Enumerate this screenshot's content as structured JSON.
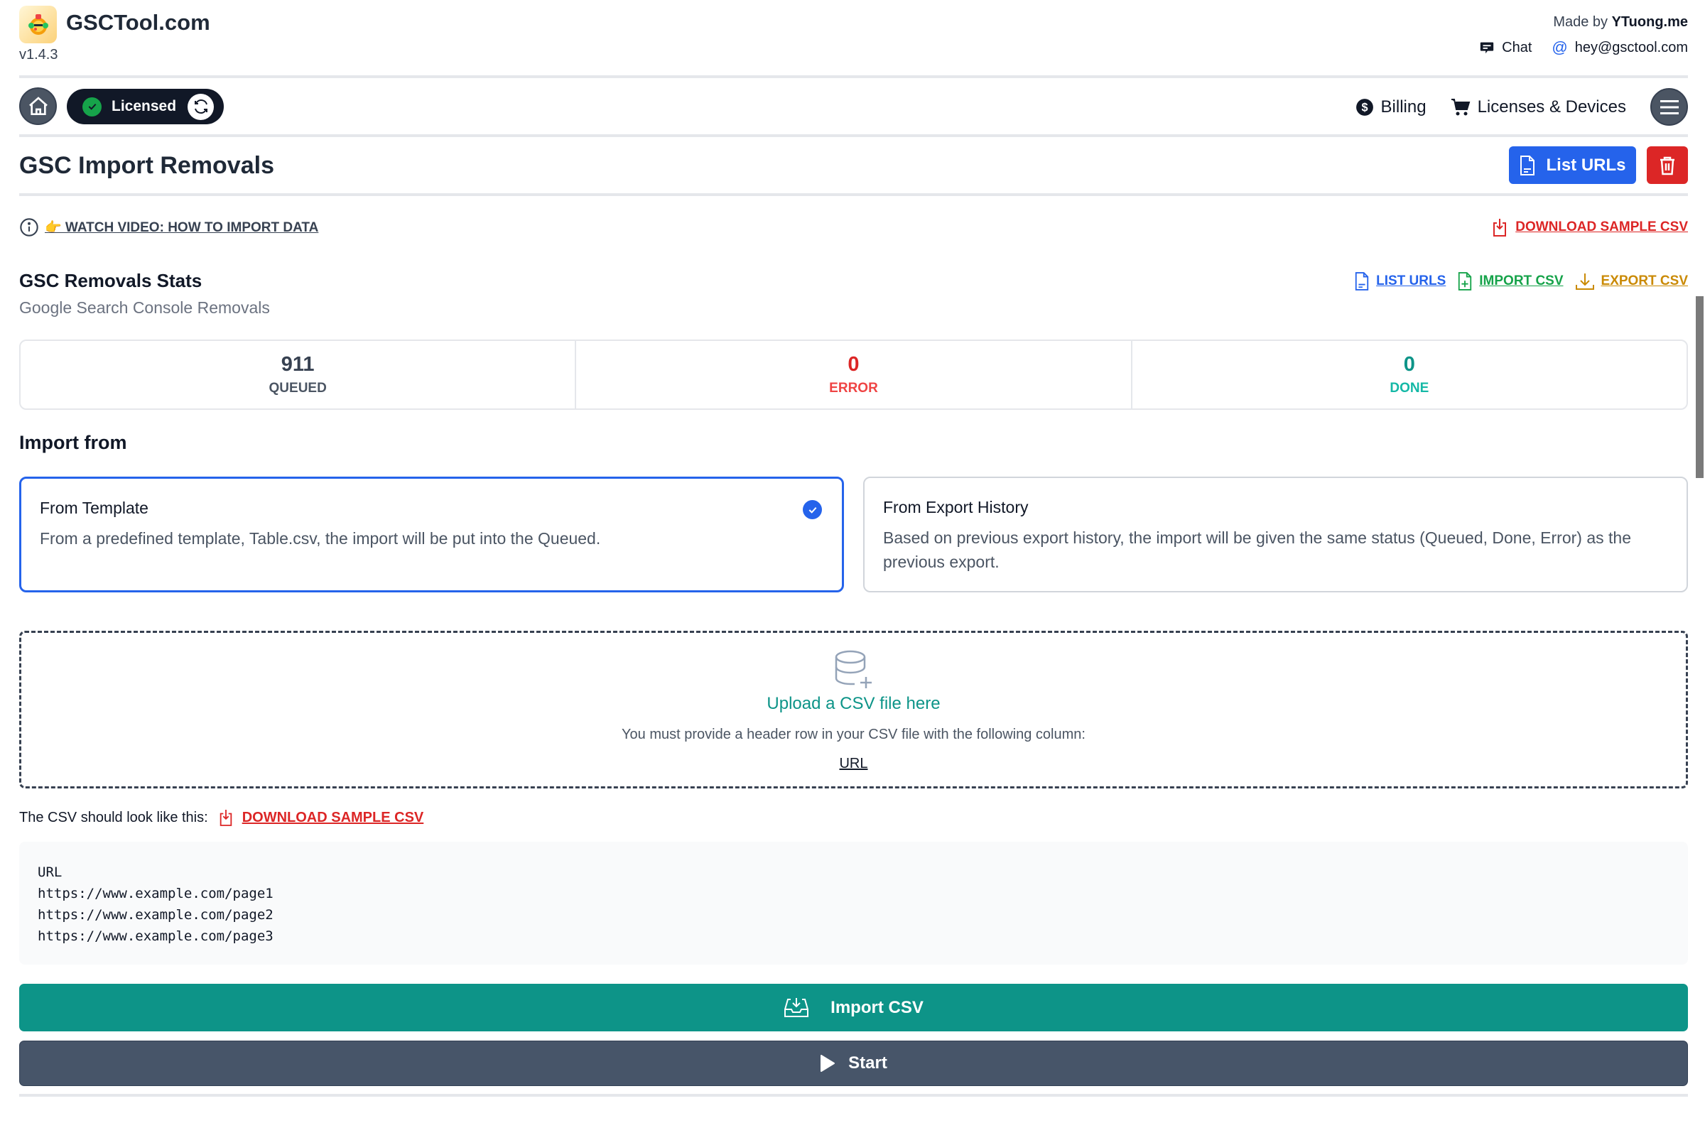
{
  "header": {
    "brand": "GSCTool.com",
    "version": "v1.4.3",
    "made_by_prefix": "Made by",
    "made_by_name": "YTuong.me",
    "chat_label": "Chat",
    "email": "hey@gsctool.com"
  },
  "nav": {
    "license_status": "Licensed",
    "billing_label": "Billing",
    "licenses_label": "Licenses & Devices"
  },
  "page": {
    "title": "GSC Import Removals",
    "list_urls_button": "List URLs",
    "watch_video": "👉 WATCH VIDEO: HOW TO IMPORT DATA",
    "download_sample": "DOWNLOAD SAMPLE CSV"
  },
  "stats": {
    "title": "GSC Removals Stats",
    "subtitle": "Google Search Console Removals",
    "links": {
      "list_urls": "LIST URLS",
      "import_csv": "IMPORT CSV",
      "export_csv": "EXPORT CSV"
    },
    "items": [
      {
        "value": "911",
        "label": "QUEUED",
        "color": "#374151",
        "label_color": "#4b5563"
      },
      {
        "value": "0",
        "label": "ERROR",
        "color": "#dc2626",
        "label_color": "#ef4444"
      },
      {
        "value": "0",
        "label": "DONE",
        "color": "#0d9488",
        "label_color": "#14b8a6"
      }
    ]
  },
  "import_from": {
    "heading": "Import from",
    "options": [
      {
        "title": "From Template",
        "description": "From a predefined template, Table.csv, the import will be put into the Queued.",
        "selected": true
      },
      {
        "title": "From Export History",
        "description": "Based on previous export history, the import will be given the same status (Queued, Done, Error) as the previous export.",
        "selected": false
      }
    ]
  },
  "upload": {
    "title": "Upload a CSV file here",
    "description": "You must provide a header row in your CSV file with the following column:",
    "column": "URL"
  },
  "sample": {
    "label": "The CSV should look like this:",
    "download_label": "DOWNLOAD SAMPLE CSV",
    "lines": [
      "URL",
      "https://www.example.com/page1",
      "https://www.example.com/page2",
      "https://www.example.com/page3"
    ]
  },
  "actions": {
    "import_csv": "Import CSV",
    "start": "Start"
  },
  "colors": {
    "primary": "#2563eb",
    "danger": "#dc2626",
    "teal": "#0d9488",
    "slate": "#475569",
    "import_green": "#16a34a",
    "export_amber": "#ca8a04"
  }
}
